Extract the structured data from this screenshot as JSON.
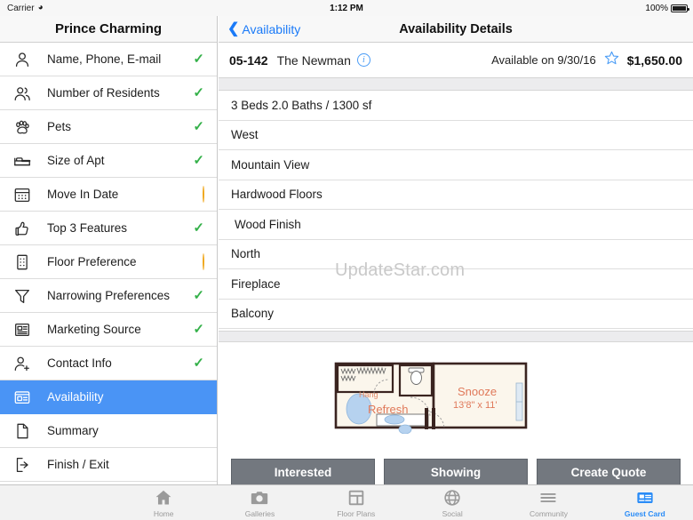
{
  "status_bar": {
    "carrier": "Carrier",
    "wifi_icon": "wifi-icon",
    "time": "1:12 PM",
    "battery_percent": "100%",
    "battery_icon": "battery-full-icon"
  },
  "sidebar": {
    "title": "Prince Charming",
    "items": [
      {
        "label": "Name, Phone, E-mail",
        "icon": "person-icon",
        "status": "check",
        "selected": false
      },
      {
        "label": "Number of Residents",
        "icon": "people-icon",
        "status": "check",
        "selected": false
      },
      {
        "label": "Pets",
        "icon": "paw-icon",
        "status": "check",
        "selected": false
      },
      {
        "label": "Size of Apt",
        "icon": "bed-icon",
        "status": "check",
        "selected": false
      },
      {
        "label": "Move In Date",
        "icon": "calendar-icon",
        "status": "dash",
        "selected": false
      },
      {
        "label": "Top 3 Features",
        "icon": "thumbs-up-icon",
        "status": "check",
        "selected": false
      },
      {
        "label": "Floor Preference",
        "icon": "building-icon",
        "status": "dash",
        "selected": false
      },
      {
        "label": "Narrowing Preferences",
        "icon": "funnel-icon",
        "status": "check",
        "selected": false
      },
      {
        "label": "Marketing Source",
        "icon": "newspaper-icon",
        "status": "check",
        "selected": false
      },
      {
        "label": "Contact Info",
        "icon": "person-add-icon",
        "status": "check",
        "selected": false
      },
      {
        "label": "Availability",
        "icon": "id-card-icon",
        "status": "none",
        "selected": true
      },
      {
        "label": "Summary",
        "icon": "document-icon",
        "status": "none",
        "selected": false
      },
      {
        "label": "Finish / Exit",
        "icon": "exit-icon",
        "status": "none",
        "selected": false
      }
    ],
    "check_color": "#35b14a",
    "dash_color": "#f0a81e",
    "selected_color": "#4a94f5"
  },
  "detail": {
    "nav": {
      "back_label": "Availability",
      "back_icon": "chevron-left-icon",
      "title": "Availability Details",
      "accent_color": "#1a7af8"
    },
    "unit": {
      "unit_number": "05-142",
      "unit_name": "The Newman",
      "info_icon": "info-circle-icon",
      "availability": "Available on 9/30/16",
      "favorite_icon": "star-outline-icon",
      "price": "$1,650.00"
    },
    "features": [
      "3 Beds 2.0 Baths / 1300 sf",
      "West",
      "Mountain View",
      "Hardwood Floors",
      "Wood Finish",
      "North",
      "Fireplace",
      "Balcony"
    ],
    "watermark": "UpdateStar.com",
    "floor_plan": {
      "icon": "floor-plan-image",
      "room_labels": [
        "Hang",
        "Refresh",
        "Snooze"
      ],
      "room_dimensions": "13'8\" x 11'",
      "snooze_label": "Snooze"
    },
    "actions": [
      {
        "label": "Interested"
      },
      {
        "label": "Showing"
      },
      {
        "label": "Create Quote"
      }
    ]
  },
  "tabbar": {
    "tabs": [
      {
        "label": "Home",
        "icon": "home-icon",
        "active": false
      },
      {
        "label": "Galleries",
        "icon": "camera-icon",
        "active": false
      },
      {
        "label": "Floor Plans",
        "icon": "floorplan-icon",
        "active": false
      },
      {
        "label": "Social",
        "icon": "globe-icon",
        "active": false
      },
      {
        "label": "Community",
        "icon": "menu-lines-icon",
        "active": false
      },
      {
        "label": "Guest Card",
        "icon": "guest-card-icon",
        "active": true
      }
    ],
    "active_color": "#2a8cf7",
    "inactive_color": "#9a9a9a"
  }
}
